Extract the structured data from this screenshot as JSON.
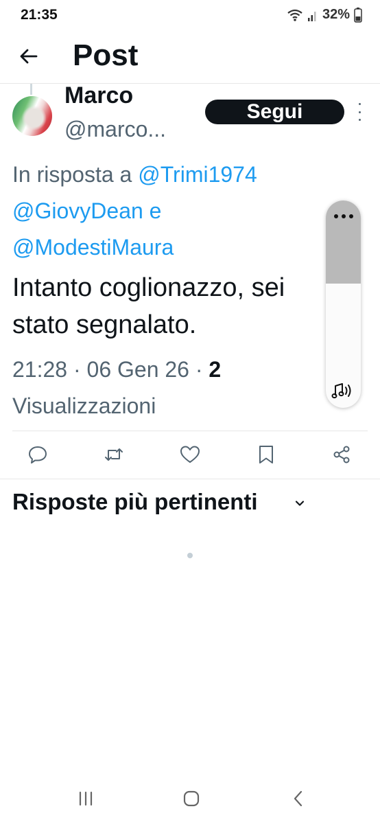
{
  "status_bar": {
    "time": "21:35",
    "battery_percent": "32%",
    "icons": [
      "wifi-icon",
      "signal-icon",
      "battery-icon"
    ]
  },
  "header": {
    "title": "Post",
    "back_icon": "back-arrow-icon"
  },
  "post": {
    "author_name": "Marco",
    "author_handle": "@marco...",
    "follow_label": "Segui",
    "reply_prefix": "In risposta a ",
    "mentions": [
      "@Trimi1974",
      "@GiovyDean",
      "@ModestiMaura"
    ],
    "mention_joiner": " e",
    "text": "Intanto coglionazzo, sei stato segnalato.",
    "time": "21:28",
    "separator": " · ",
    "date": "06 Gen 26",
    "views_count": "2",
    "views_label": "Visualizzazioni"
  },
  "actions": [
    "reply-icon",
    "repost-icon",
    "like-icon",
    "bookmark-icon",
    "share-icon"
  ],
  "replies": {
    "sort_label": "Risposte più pertinenti"
  },
  "volume_panel": {
    "level_fraction": 0.6,
    "icon": "media-volume-icon"
  },
  "colors": {
    "text": "#0f1419",
    "secondary": "#536471",
    "link": "#1d9bf0",
    "button_dark": "#0f1419"
  }
}
